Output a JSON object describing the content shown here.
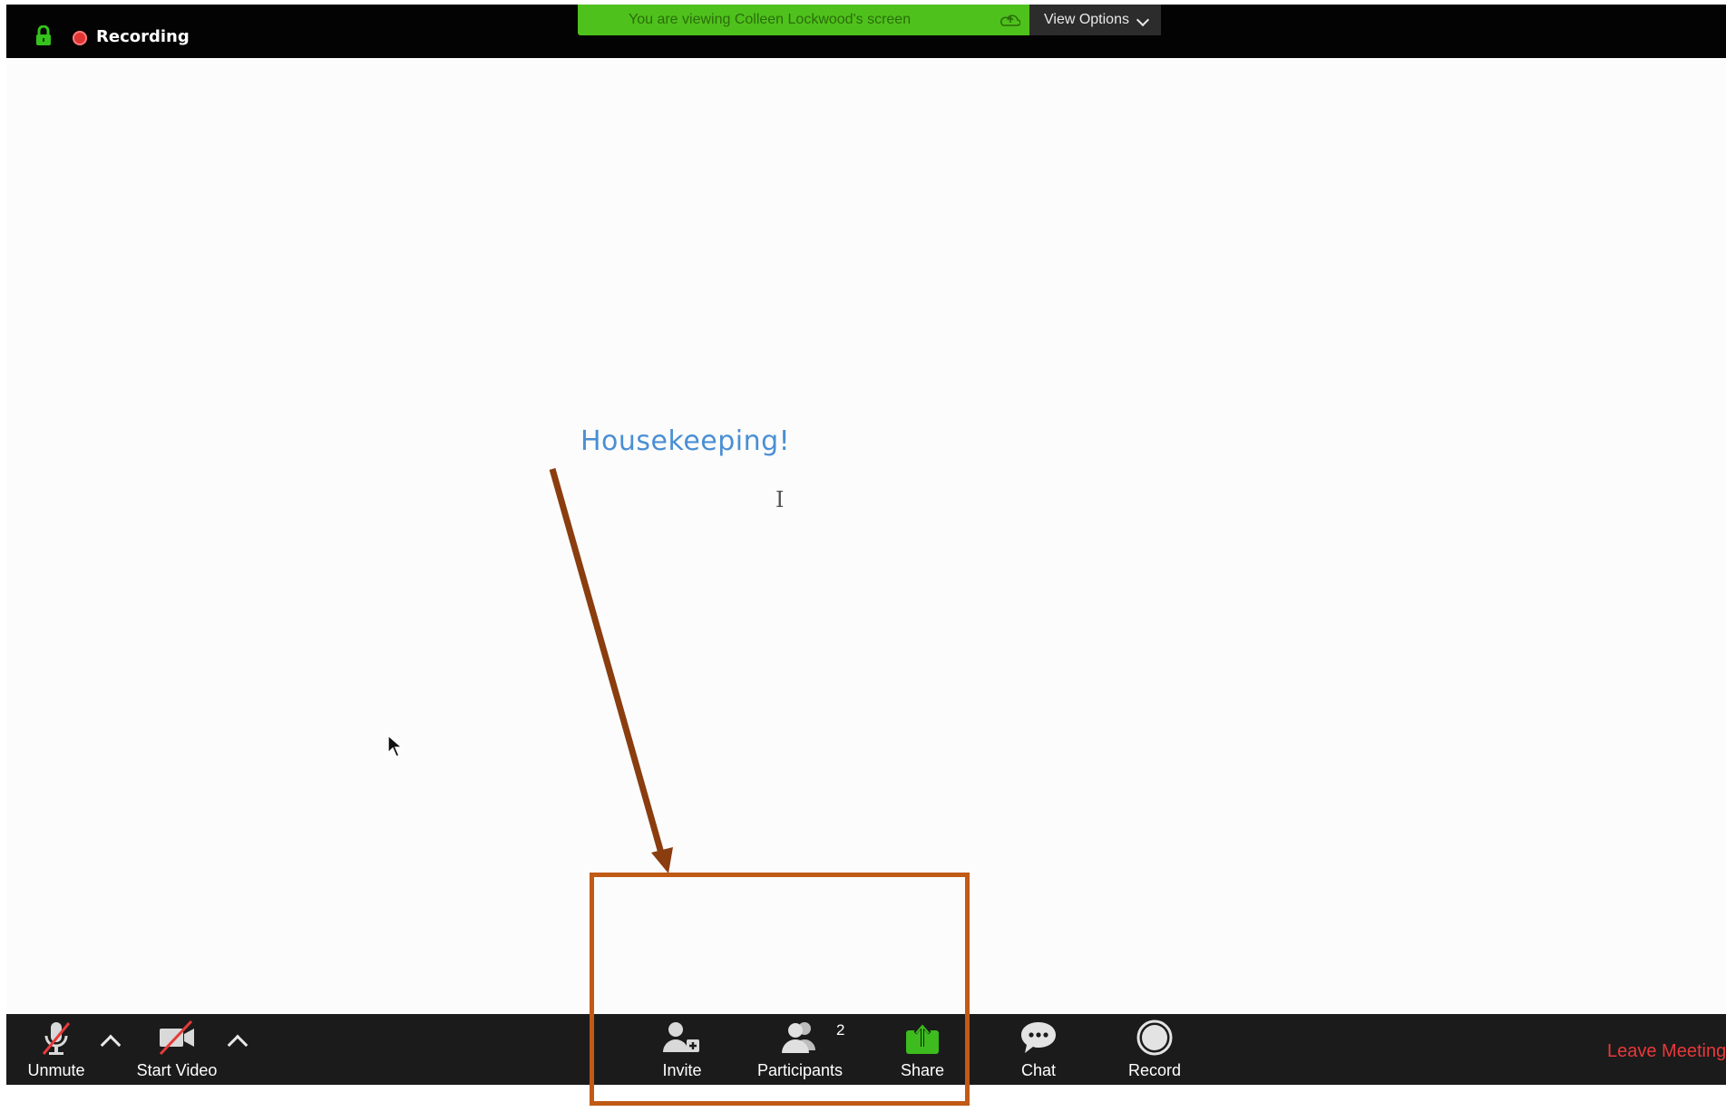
{
  "topbar": {
    "recording_label": "Recording",
    "share_banner": "You are viewing Colleen Lockwood's screen",
    "view_options_label": "View Options"
  },
  "content": {
    "slide_title": "Housekeeping!",
    "text_cursor": "I"
  },
  "toolbar": {
    "unmute_label": "Unmute",
    "start_video_label": "Start Video",
    "invite_label": "Invite",
    "participants_label": "Participants",
    "participants_count": "2",
    "share_label": "Share",
    "chat_label": "Chat",
    "record_label": "Record",
    "leave_label": "Leave Meeting"
  },
  "colors": {
    "banner_green": "#4fc11c",
    "share_green": "#3dbb1f",
    "leave_red": "#e7393b",
    "annotation_orange": "#c05a15",
    "arrow_brown": "#8a3d0f",
    "title_blue": "#4a8fd4"
  }
}
